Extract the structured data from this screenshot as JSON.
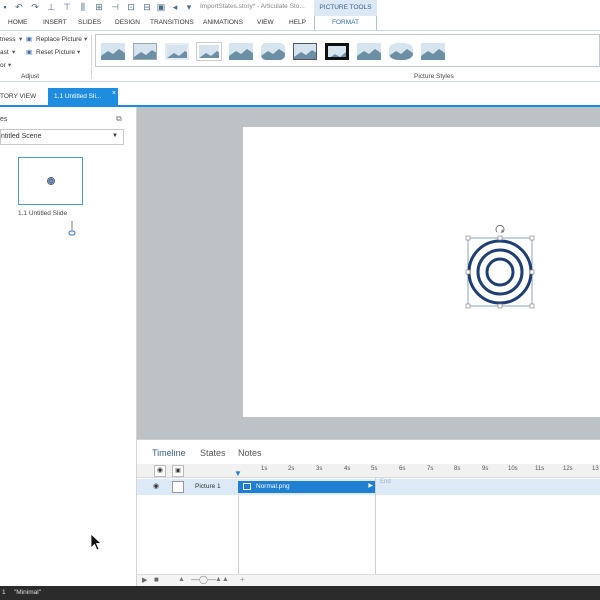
{
  "titlebar": {
    "title": "ImportStates.story* - Articulate Sto...",
    "contextual_tab": "PICTURE TOOLS"
  },
  "ribbon": {
    "tabs": [
      "HOME",
      "INSERT",
      "SLIDES",
      "DESIGN",
      "TRANSITIONS",
      "ANIMATIONS",
      "VIEW",
      "HELP",
      "FORMAT"
    ],
    "active_tab": "FORMAT",
    "adjust": {
      "brightness": "tness",
      "contrast": "ast",
      "color": "or",
      "replace_picture": "Replace Picture",
      "reset_picture": "Reset Picture",
      "group_label": "Adjust"
    },
    "picture_styles_label": "Picture Styles"
  },
  "doc_tabs": {
    "story_view": "TORY VIEW",
    "slide_tab": "1.1 Untitled Sli...",
    "close": "×"
  },
  "scenes": {
    "label": "es",
    "dropdown_value": "ntitled Scene",
    "slide_label": "1.1 Untitled Slide"
  },
  "timeline": {
    "tabs": [
      "Timeline",
      "States",
      "Notes"
    ],
    "active_tab": "Timeline",
    "ticks": [
      "1s",
      "2s",
      "3s",
      "4s",
      "5s",
      "6s",
      "7s",
      "8s",
      "9s",
      "10s",
      "11s",
      "12s",
      "13"
    ],
    "row_label": "Picture 1",
    "bar_label": "Normal.png",
    "end_label": "End"
  },
  "statusbar": {
    "page": "1",
    "theme": "\"Minimal\""
  },
  "colors": {
    "accent_blue": "#1e8de0",
    "canvas_gray": "#bdc2c7",
    "ring_navy": "#1f3f73"
  }
}
